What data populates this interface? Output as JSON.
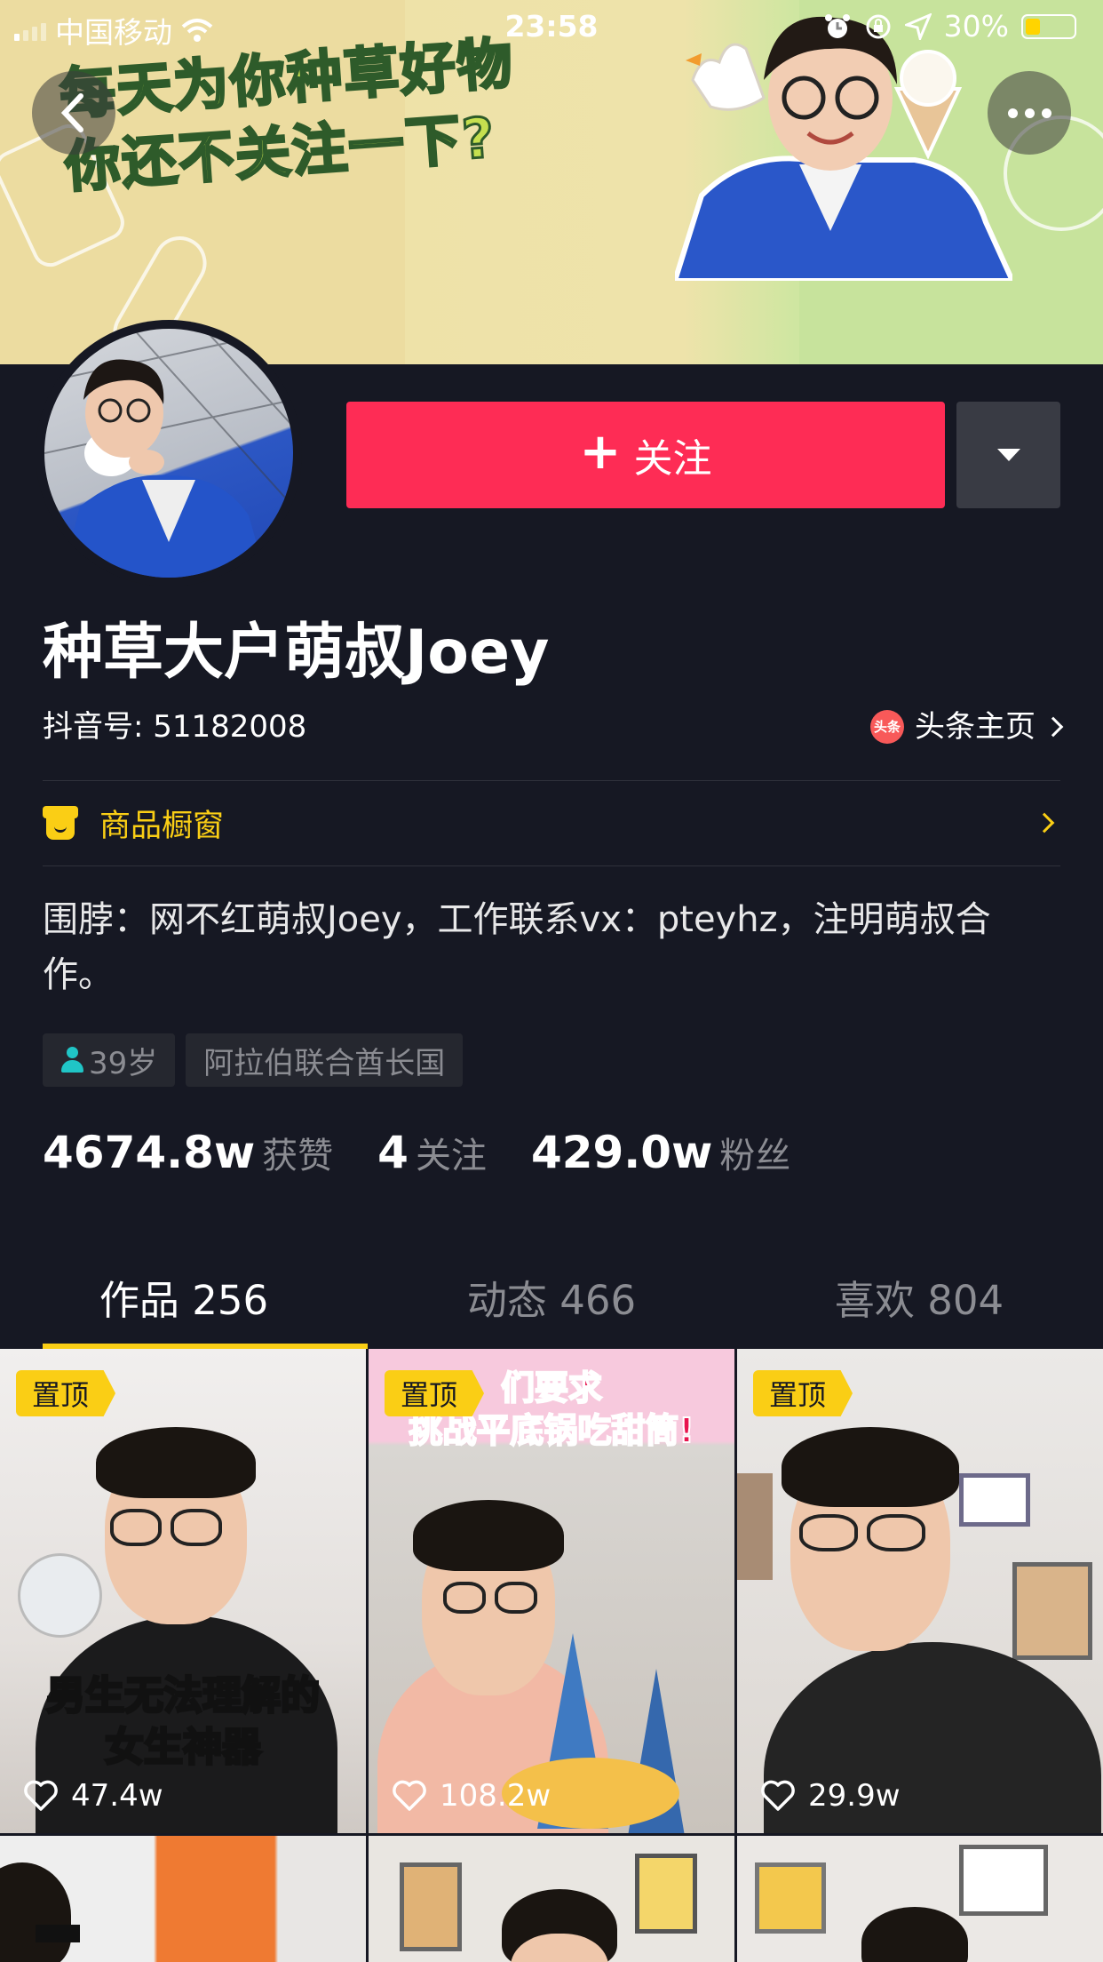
{
  "status_bar": {
    "carrier": "中国移动",
    "time": "23:58",
    "battery": "30%"
  },
  "banner": {
    "line1": "每天为你种草好物",
    "line2": "你还不关注一下?"
  },
  "profile": {
    "follow_label": "关注",
    "name": "种草大户萌叔Joey",
    "douyin_id": "抖音号: 51182008",
    "toutiao_label": "头条主页",
    "toutiao_logo": "头条",
    "shop_label": "商品橱窗",
    "bio": "围脖：网不红萌叔Joey，工作联系vx：pteyhz，注明萌叔合作。",
    "tags": [
      "39岁",
      "阿拉伯联合酋长国"
    ],
    "stats": [
      {
        "value": "4674.8w",
        "label": "获赞"
      },
      {
        "value": "4",
        "label": "关注"
      },
      {
        "value": "429.0w",
        "label": "粉丝"
      }
    ]
  },
  "tabs": [
    {
      "label": "作品 256",
      "active": true
    },
    {
      "label": "动态 466",
      "active": false
    },
    {
      "label": "喜欢 804",
      "active": false
    }
  ],
  "videos": [
    {
      "pinned_label": "置顶",
      "likes": "47.4w",
      "caption": "男生无法理解的女生神器",
      "caption_l1": "男生无法理解的",
      "caption_l2": "女生神器"
    },
    {
      "pinned_label": "置顶",
      "likes": "108.2w",
      "caption_l1": "们要求",
      "caption_l2": "挑战平底锅吃甜筒!"
    },
    {
      "pinned_label": "置顶",
      "likes": "29.9w"
    }
  ],
  "colors": {
    "background": "#161823",
    "accent": "#fe2c55",
    "highlight": "#face15"
  }
}
